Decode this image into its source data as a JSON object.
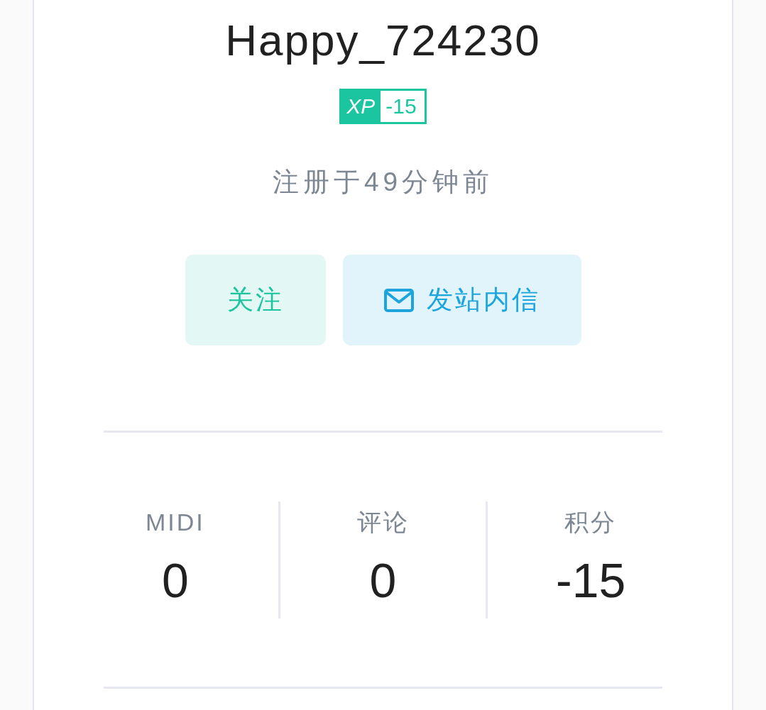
{
  "profile": {
    "username": "Happy_724230",
    "xp_badge": {
      "label": "XP",
      "value": "-15"
    },
    "registered": "注册于49分钟前"
  },
  "actions": [
    {
      "kind": "follow",
      "label": "关注"
    },
    {
      "kind": "message",
      "label": "发站内信"
    }
  ],
  "stats": [
    {
      "label": "MIDI",
      "value": "0"
    },
    {
      "label": "评论",
      "value": "0"
    },
    {
      "label": "积分",
      "value": "-15"
    }
  ]
}
